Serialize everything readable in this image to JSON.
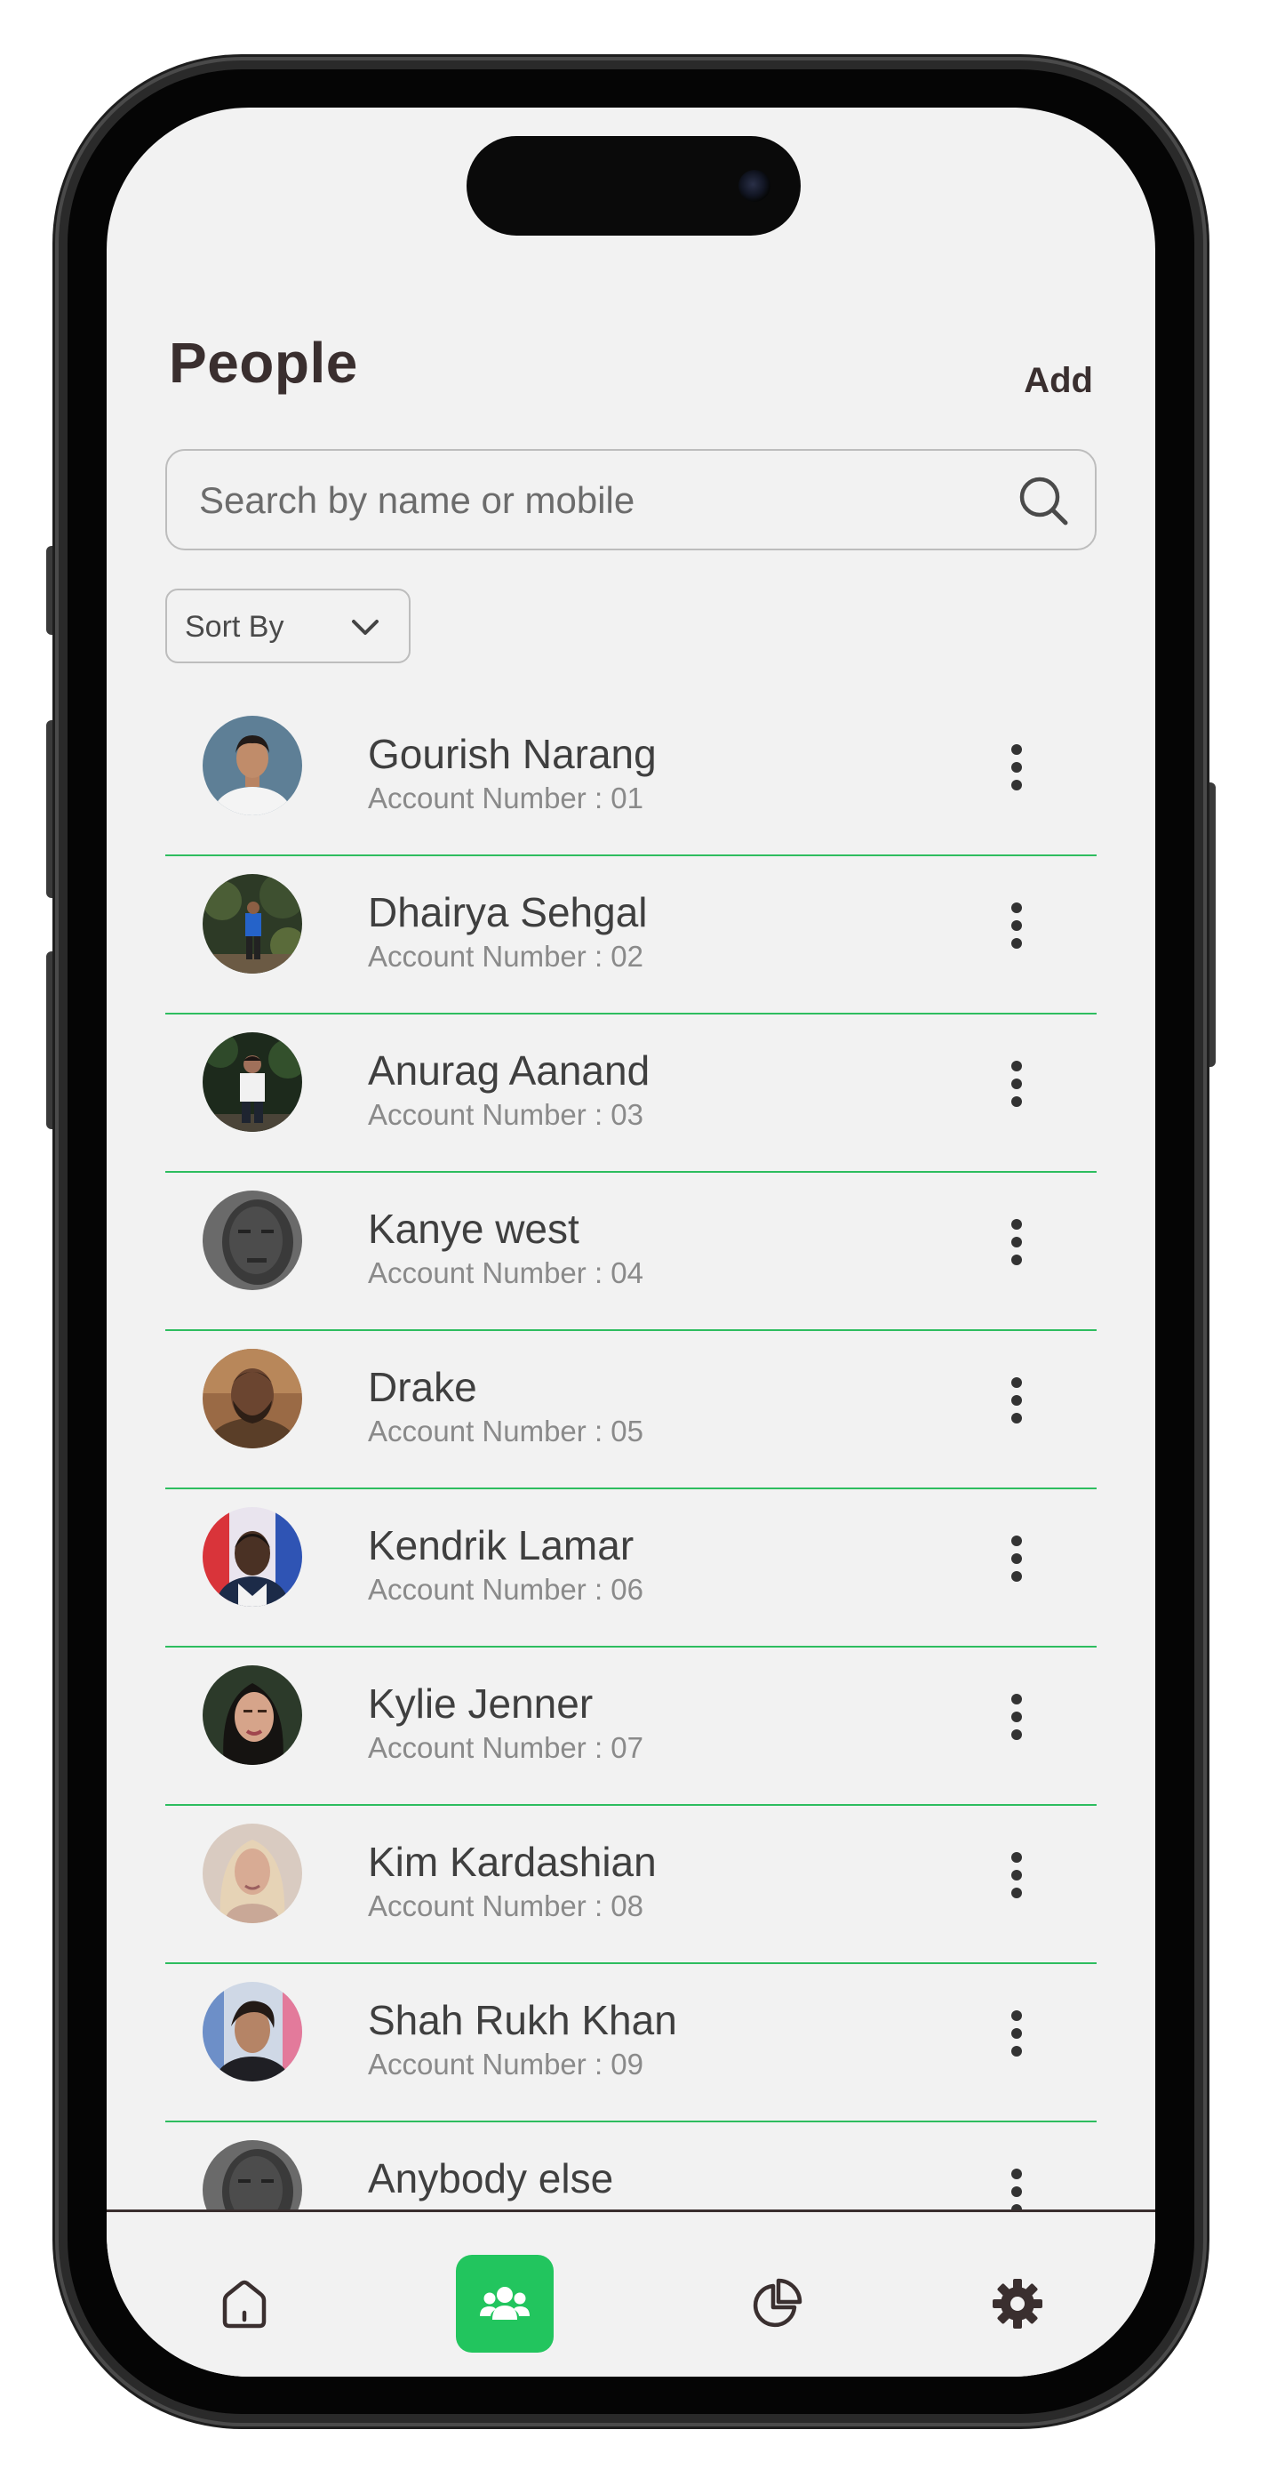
{
  "header": {
    "title": "People",
    "add_label": "Add"
  },
  "search": {
    "placeholder": "Search by name or mobile",
    "value": ""
  },
  "sort": {
    "label": "Sort By"
  },
  "people": [
    {
      "name": "Gourish Narang",
      "account": "Account Number : 01"
    },
    {
      "name": "Dhairya Sehgal",
      "account": "Account Number : 02"
    },
    {
      "name": "Anurag Aanand",
      "account": "Account Number : 03"
    },
    {
      "name": "Kanye west",
      "account": "Account Number : 04"
    },
    {
      "name": "Drake",
      "account": "Account Number : 05"
    },
    {
      "name": "Kendrik Lamar",
      "account": "Account Number : 06"
    },
    {
      "name": "Kylie Jenner",
      "account": "Account Number : 07"
    },
    {
      "name": "Kim Kardashian",
      "account": "Account Number : 08"
    },
    {
      "name": "Shah Rukh Khan",
      "account": "Account Number : 09"
    },
    {
      "name": "Anybody else",
      "account": ""
    }
  ],
  "nav": {
    "items": [
      {
        "icon": "home-icon",
        "active": false
      },
      {
        "icon": "people-icon",
        "active": true
      },
      {
        "icon": "pie-chart-icon",
        "active": false
      },
      {
        "icon": "gear-icon",
        "active": false
      }
    ]
  },
  "colors": {
    "accent": "#22c55e",
    "divider": "#2ebd5f",
    "text_primary": "#3a2f2f",
    "background": "#f2f2f2"
  }
}
